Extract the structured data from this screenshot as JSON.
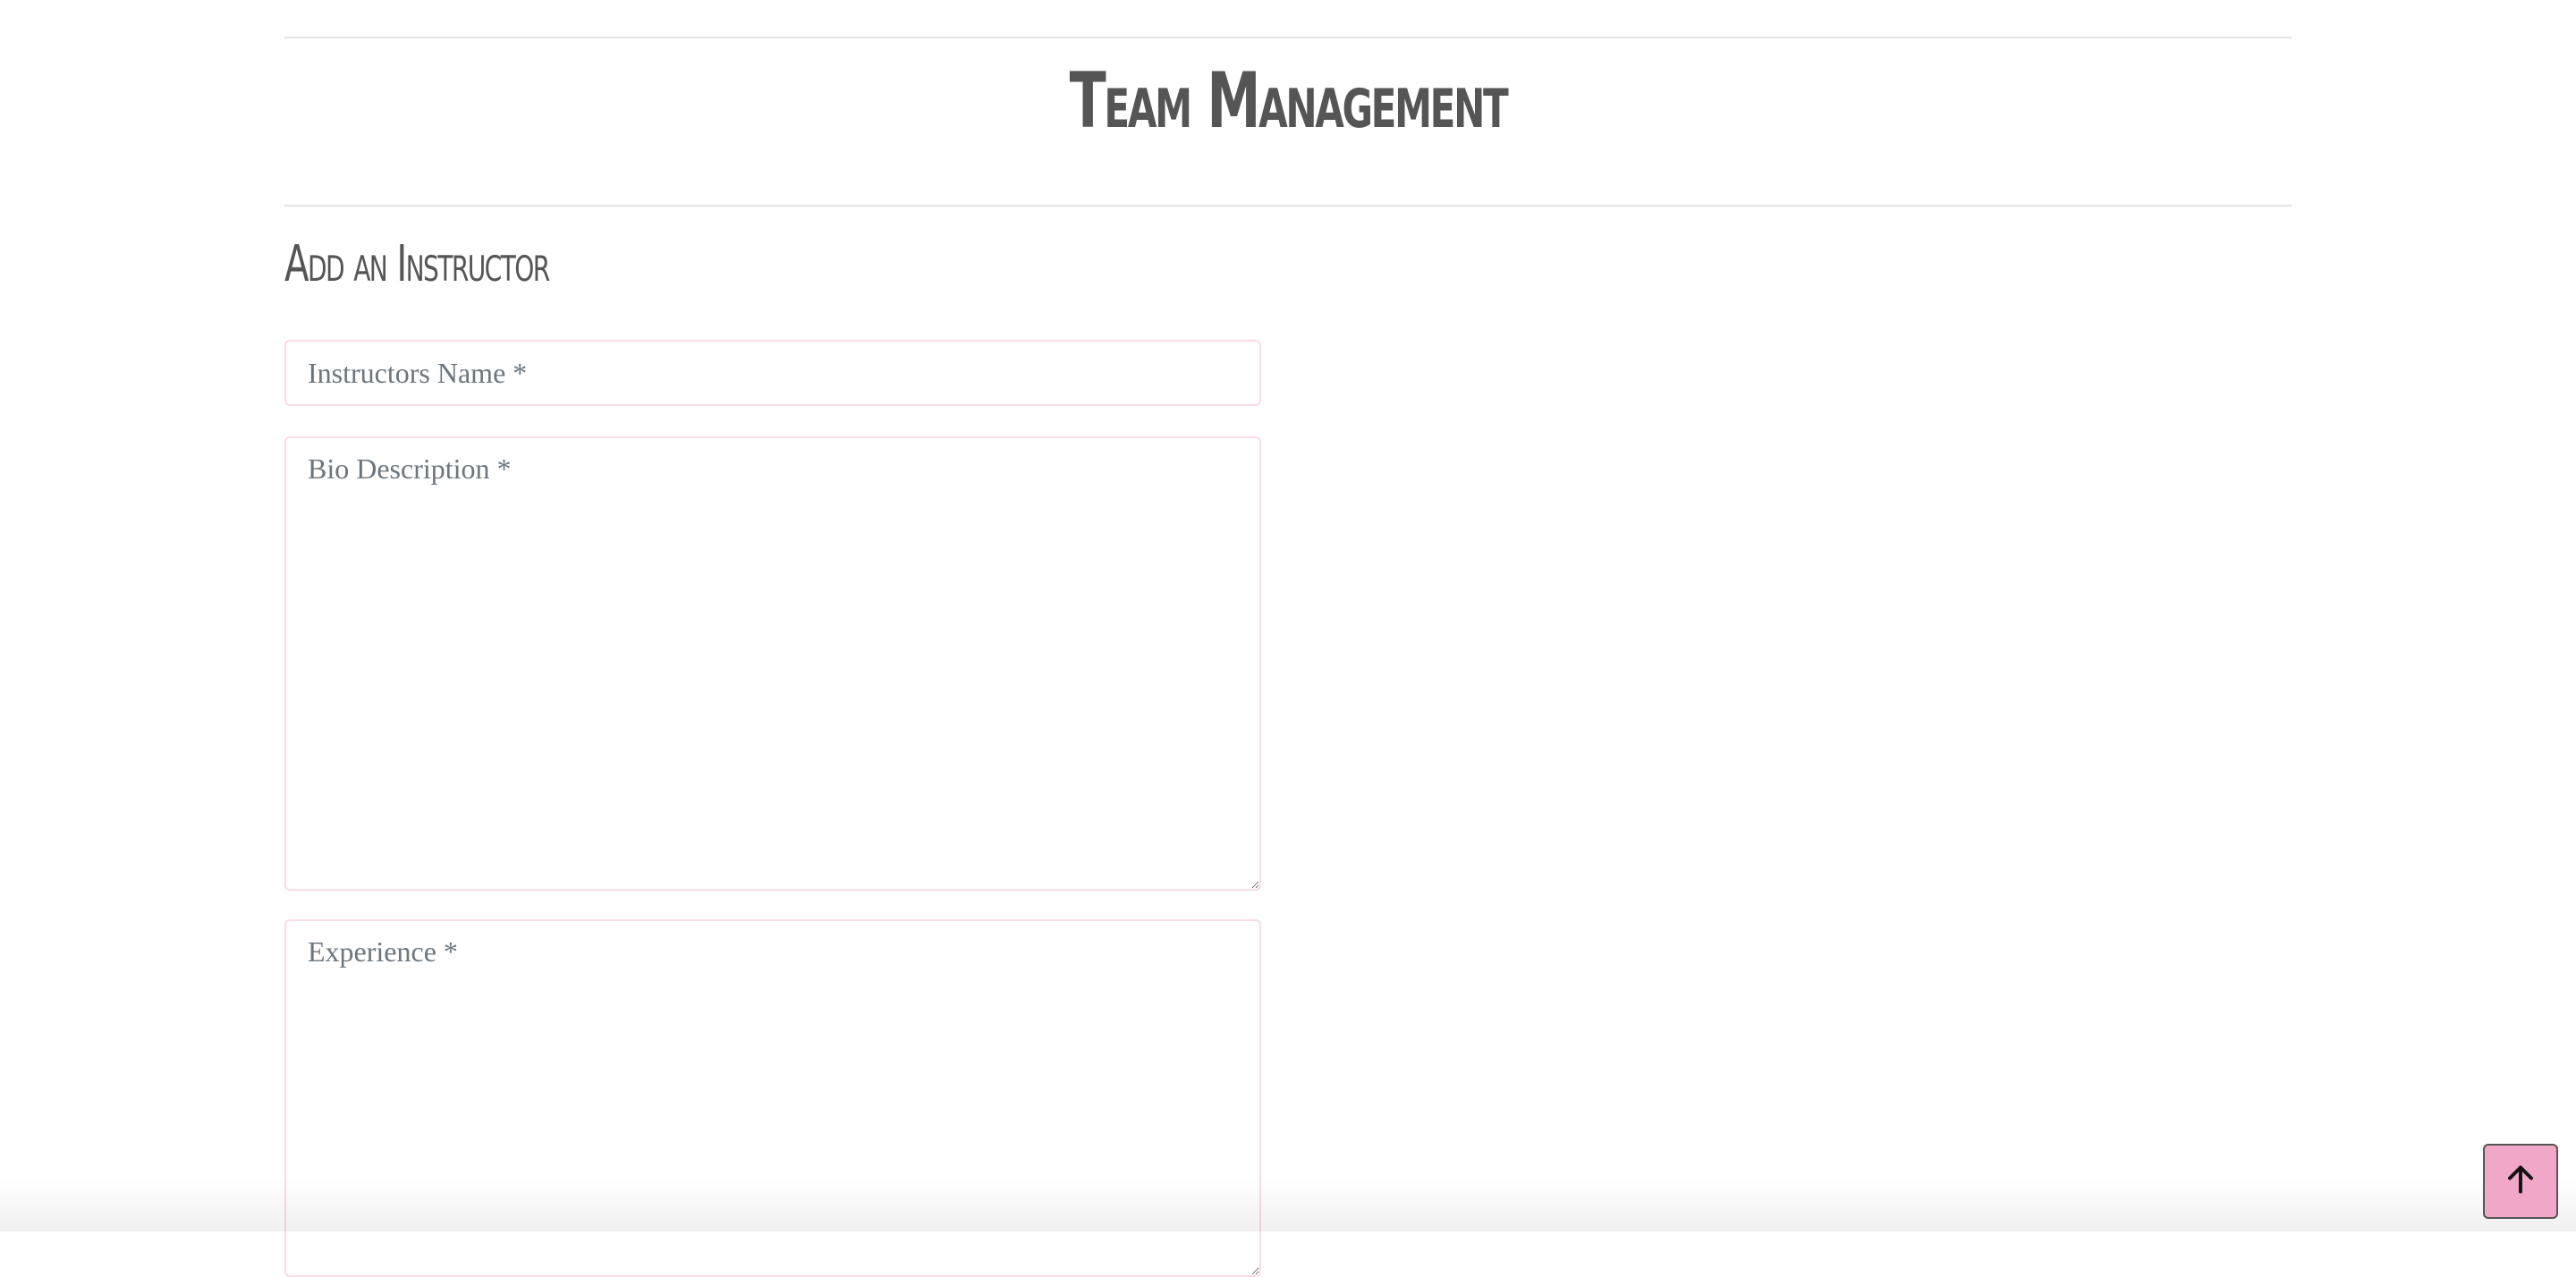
{
  "header": {
    "title": "Team Management"
  },
  "form": {
    "section_title": "Add an Instructor",
    "name_placeholder": "Instructors Name *",
    "bio_placeholder": "Bio Description *",
    "experience_placeholder": "Experience *"
  },
  "back_to_top": {
    "icon": "arrow-up-icon",
    "color": "#f1a7c7"
  },
  "colors": {
    "field_border": "#fbdbe6",
    "heading_text": "#555555"
  }
}
